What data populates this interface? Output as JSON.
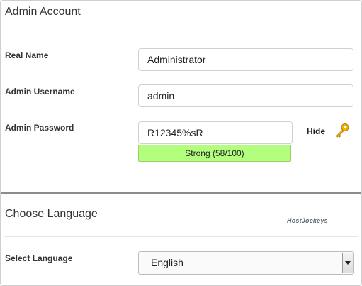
{
  "admin_account": {
    "title": "Admin Account",
    "real_name": {
      "label": "Real Name",
      "value": "Administrator"
    },
    "username": {
      "label": "Admin Username",
      "value": "admin"
    },
    "password": {
      "label": "Admin Password",
      "value": "R12345%sR",
      "strength_text": "Strong (58/100)",
      "hide_label": "Hide",
      "toggle_icon": "key-icon"
    }
  },
  "choose_language": {
    "title": "Choose Language",
    "watermark": "HostJockeys",
    "select_label": "Select Language",
    "selected": "English"
  },
  "colors": {
    "strength_fill": "#b2ff7e",
    "key_icon": "#e5a400",
    "divider": "#8c8c8c"
  }
}
